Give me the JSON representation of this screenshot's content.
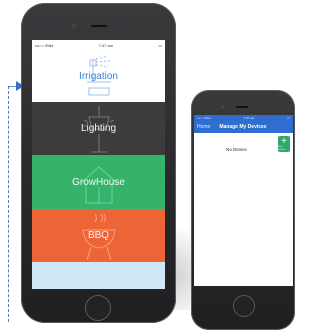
{
  "left_phone": {
    "status": {
      "carrier": "•••○○ iRiet",
      "wifi": "wifi-icon",
      "time": "7:47 am",
      "battery": "battery-icon"
    },
    "tiles": [
      {
        "label": "Irrigation",
        "icon": "sprinkler-icon",
        "color": "#ffffff"
      },
      {
        "label": "Lighting",
        "icon": "lamp-icon",
        "color": "#3c3c3c"
      },
      {
        "label": "GrowHouse",
        "icon": "greenhouse-icon",
        "color": "#36b36a"
      },
      {
        "label": "BBQ",
        "icon": "grill-icon",
        "color": "#ed6437"
      }
    ]
  },
  "right_phone": {
    "status": {
      "carrier": "•••○○ iRiet",
      "time": "7:47 am"
    },
    "nav": {
      "back": "Home",
      "title": "Manage My Devices"
    },
    "empty_text": "No Device",
    "add_button": {
      "symbol": "+",
      "caption": "ADD DEVICE"
    },
    "accent": "#2f6dd1"
  },
  "colors": {
    "arrow": "#4a7cc8"
  }
}
